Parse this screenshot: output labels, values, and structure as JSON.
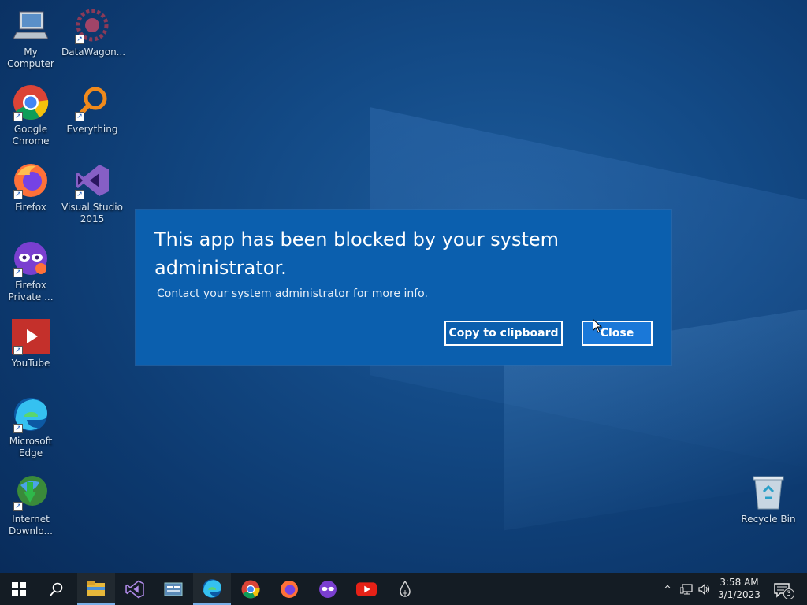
{
  "desktop": {
    "icons": [
      {
        "id": "my-computer",
        "label": "My Computer"
      },
      {
        "id": "datawagon",
        "label": "DataWagon..."
      },
      {
        "id": "chrome",
        "label": "Google Chrome"
      },
      {
        "id": "everything",
        "label": "Everything"
      },
      {
        "id": "firefox",
        "label": "Firefox"
      },
      {
        "id": "visual-studio",
        "label": "Visual Studio 2015"
      },
      {
        "id": "firefox-private",
        "label": "Firefox Private ..."
      },
      {
        "id": "youtube",
        "label": "YouTube"
      },
      {
        "id": "edge",
        "label": "Microsoft Edge"
      },
      {
        "id": "idm",
        "label": "Internet Downlo..."
      },
      {
        "id": "recycle-bin",
        "label": "Recycle Bin"
      }
    ]
  },
  "dialog": {
    "title": "This app has been blocked by your system administrator.",
    "message": "Contact your system administrator for more info.",
    "copy_label": "Copy to clipboard",
    "close_label": "Close"
  },
  "taskbar": {
    "pinned": [
      "start-icon",
      "search-icon",
      "file-explorer-icon",
      "visual-studio-icon",
      "control-panel-icon",
      "edge-icon",
      "chrome-icon",
      "firefox-icon",
      "firefox-private-icon",
      "youtube-icon",
      "water-drop-icon"
    ],
    "clock_time": "3:58 AM",
    "clock_date": "3/1/2023",
    "notification_count": "3"
  },
  "colors": {
    "dialog_bg": "#0b5fae",
    "close_button": "#1a78d8",
    "taskbar": "#141c24"
  }
}
